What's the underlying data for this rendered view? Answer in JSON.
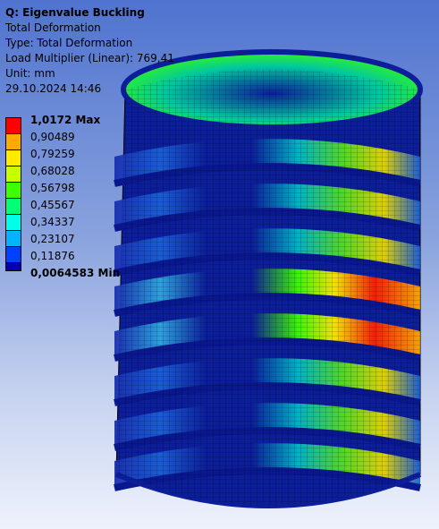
{
  "header": {
    "title": "Q: Eigenvalue Buckling",
    "result_name": "Total Deformation",
    "type_line": "Type: Total Deformation",
    "load_line": "Load Multiplier (Linear): 769,41",
    "unit_line": "Unit: mm",
    "timestamp": "29.10.2024 14:46"
  },
  "legend": {
    "labels": [
      "1,0172 Max",
      "0,90489",
      "0,79259",
      "0,68028",
      "0,56798",
      "0,45567",
      "0,34337",
      "0,23107",
      "0,11876",
      "0,0064583 Min"
    ],
    "colors": [
      "#ff0000",
      "#ffaa00",
      "#ffea00",
      "#c8ff00",
      "#3cff00",
      "#00ff74",
      "#00ffe8",
      "#00b4ff",
      "#0040ff",
      "#0000b8"
    ]
  },
  "model": {
    "description_colors": {
      "shell_dark": "#0c1e9a",
      "mesh_line": "#000000"
    }
  }
}
